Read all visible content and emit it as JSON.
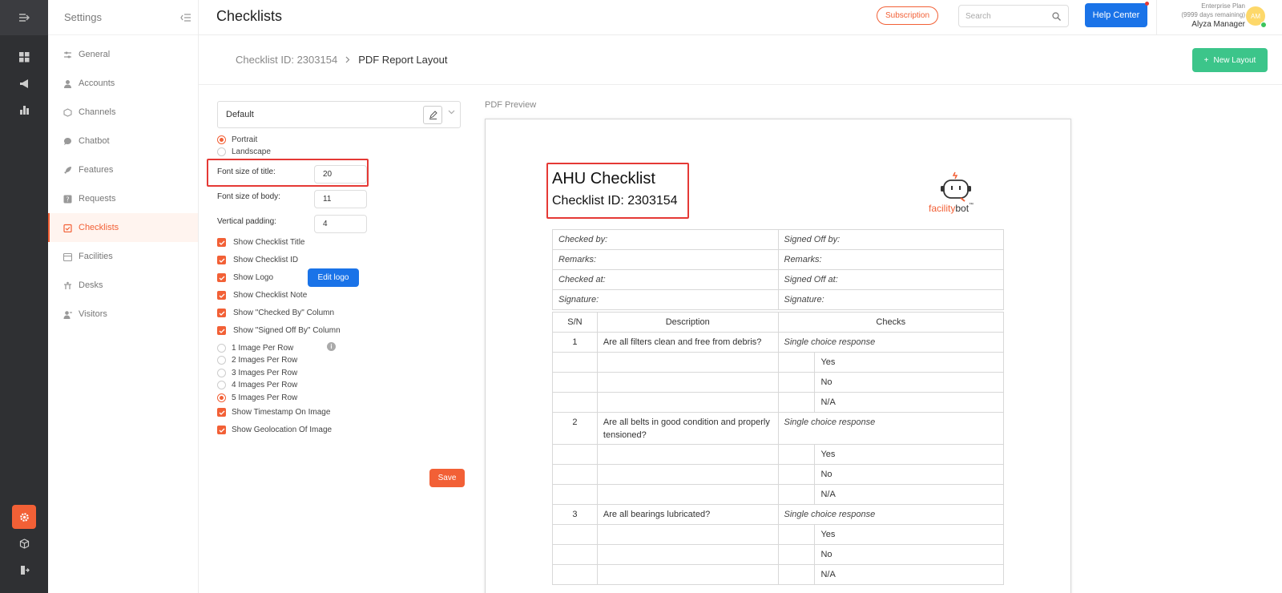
{
  "app": {
    "settings_title": "Settings",
    "page_title": "Checklists"
  },
  "sidebar": {
    "items": [
      {
        "label": "General",
        "icon": "sliders-icon"
      },
      {
        "label": "Accounts",
        "icon": "user-icon"
      },
      {
        "label": "Channels",
        "icon": "cube-icon"
      },
      {
        "label": "Chatbot",
        "icon": "chat-bubble-icon"
      },
      {
        "label": "Features",
        "icon": "rocket-icon"
      },
      {
        "label": "Requests",
        "icon": "question-square-icon"
      },
      {
        "label": "Checklists",
        "icon": "clipboard-check-icon",
        "active": true
      },
      {
        "label": "Facilities",
        "icon": "calendar-icon"
      },
      {
        "label": "Desks",
        "icon": "desk-icon"
      },
      {
        "label": "Visitors",
        "icon": "visitor-icon"
      }
    ]
  },
  "header": {
    "subscription_label": "Subscription",
    "search_placeholder": "Search",
    "help_label": "Help Center",
    "plan_line1": "Enterprise Plan",
    "plan_line2": "(9999 days remaining)",
    "user_name": "Alyza Manager",
    "avatar_initials": "AM"
  },
  "breadcrumb": {
    "parent": "Checklist ID: 2303154",
    "current": "PDF Report Layout",
    "new_layout_label": "New Layout"
  },
  "form": {
    "layout_select": "Default",
    "orientation_options": [
      {
        "label": "Portrait",
        "selected": true
      },
      {
        "label": "Landscape",
        "selected": false
      }
    ],
    "title_font_label": "Font size of title:",
    "title_font_value": "20",
    "body_font_label": "Font size of body:",
    "body_font_value": "11",
    "padding_label": "Vertical padding:",
    "padding_value": "4",
    "checkboxes": [
      "Show Checklist Title",
      "Show Checklist ID",
      "Show Logo",
      "Show Checklist Note",
      "Show \"Checked By\" Column",
      "Show \"Signed Off By\" Column"
    ],
    "edit_logo_label": "Edit logo",
    "image_options": [
      {
        "label": "1 Image Per Row",
        "selected": false
      },
      {
        "label": "2 Images Per Row",
        "selected": false
      },
      {
        "label": "3 Images Per Row",
        "selected": false
      },
      {
        "label": "4 Images Per Row",
        "selected": false
      },
      {
        "label": "5 Images Per Row",
        "selected": true
      }
    ],
    "image_checkboxes": [
      "Show Timestamp On Image",
      "Show Geolocation Of Image"
    ],
    "save_label": "Save"
  },
  "preview": {
    "label": "PDF Preview",
    "title": "AHU Checklist",
    "checklist_id": "Checklist ID: 2303154",
    "logo_word_1": "facility",
    "logo_word_2": "bot",
    "logo_tm": "™",
    "meta": [
      [
        "Checked by:",
        "Signed Off by:"
      ],
      [
        "Remarks:",
        "Remarks:"
      ],
      [
        "Checked at:",
        "Signed Off at:"
      ],
      [
        "Signature:",
        "Signature:"
      ]
    ],
    "table_headers": [
      "S/N",
      "Description",
      "Checks"
    ],
    "questions": [
      {
        "sn": "1",
        "description": "Are all filters clean and free from debris?",
        "response": "Single choice response",
        "options": [
          "Yes",
          "No",
          "N/A"
        ]
      },
      {
        "sn": "2",
        "description": "Are all belts in good condition and properly tensioned?",
        "response": "Single choice response",
        "options": [
          "Yes",
          "No",
          "N/A"
        ]
      },
      {
        "sn": "3",
        "description": "Are all bearings lubricated?",
        "response": "Single choice response",
        "options": [
          "Yes",
          "No",
          "N/A"
        ]
      }
    ]
  },
  "colors": {
    "accent": "#f26036",
    "primary_blue": "#1a73e8",
    "green": "#3cc58a",
    "highlight_red": "#e53935"
  }
}
